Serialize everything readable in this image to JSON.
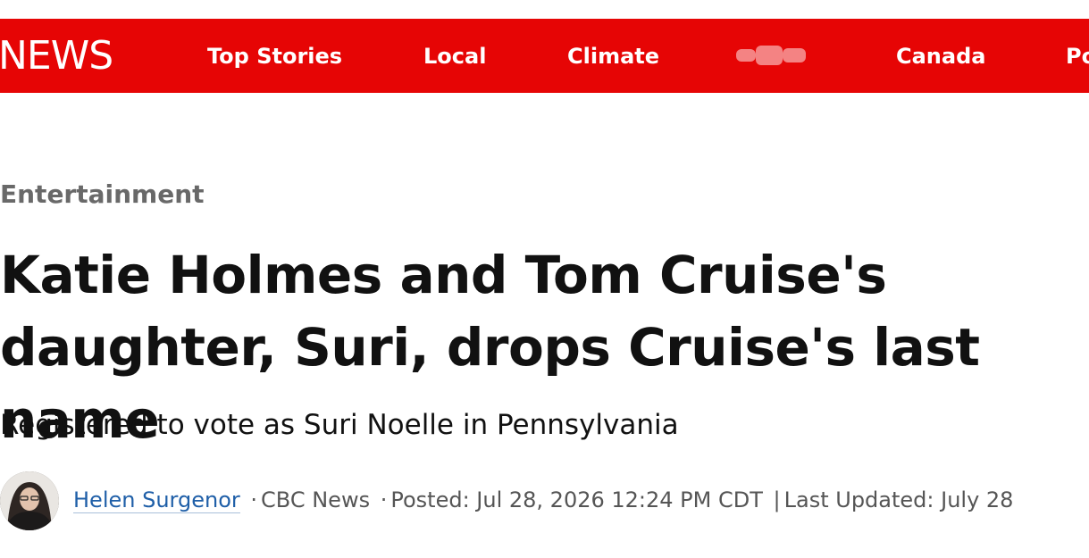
{
  "header": {
    "logo_text": "NEWS",
    "nav": [
      {
        "label": "Top Stories"
      },
      {
        "label": "Local"
      },
      {
        "label": "Climate"
      },
      {
        "label": "Canada"
      },
      {
        "label": "Po"
      }
    ],
    "background_color": "#e60505"
  },
  "article": {
    "section": "Entertainment",
    "headline": "Katie Holmes and Tom Cruise's daughter, Suri, drops Cruise's last name",
    "subheadline": "Registered to vote as Suri Noelle in Pennsylvania",
    "byline": {
      "author": "Helen Surgenor",
      "outlet": "CBC News",
      "posted": "Posted: Jul 28, 2026 12:24 PM CDT",
      "separator": "|",
      "updated": "Last Updated: July 28",
      "dot": "·"
    }
  }
}
